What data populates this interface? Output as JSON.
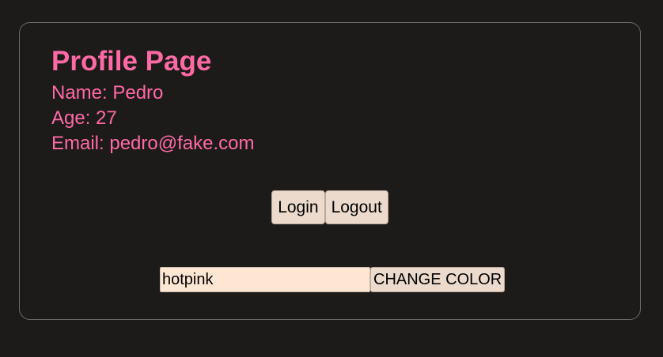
{
  "profile": {
    "title": "Profile Page",
    "name": "Name: Pedro",
    "age": "Age: 27",
    "email": "Email: pedro@fake.com",
    "text_color": "#ff69a5"
  },
  "auth": {
    "login_label": "Login",
    "logout_label": "Logout"
  },
  "color_changer": {
    "input_value": "hotpink",
    "button_label": "CHANGE COLOR"
  },
  "theme": {
    "background": "#1d1b19",
    "card_border": "#6c6965",
    "button_bg": "#ecdbcd",
    "input_bg": "#fde6d2"
  }
}
